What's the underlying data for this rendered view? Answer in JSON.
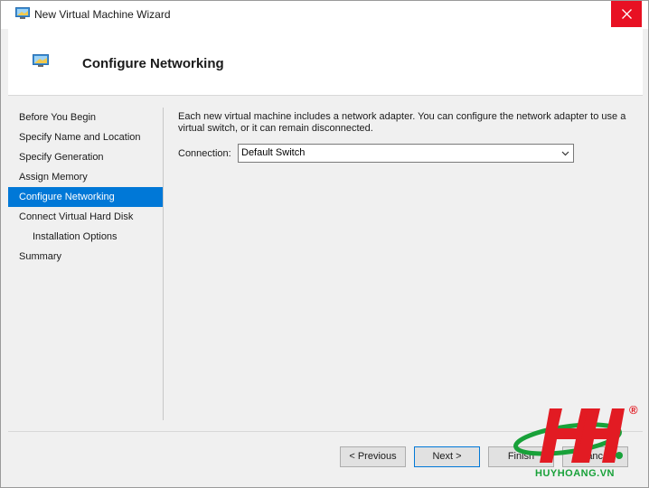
{
  "window": {
    "title": "New Virtual Machine Wizard",
    "close_icon": "close-icon"
  },
  "header": {
    "title": "Configure Networking",
    "icon": "network-monitor-icon"
  },
  "nav": {
    "items": [
      {
        "label": "Before You Begin"
      },
      {
        "label": "Specify Name and Location"
      },
      {
        "label": "Specify Generation"
      },
      {
        "label": "Assign Memory"
      },
      {
        "label": "Configure Networking"
      },
      {
        "label": "Connect Virtual Hard Disk"
      },
      {
        "label": "Installation Options"
      },
      {
        "label": "Summary"
      }
    ]
  },
  "content": {
    "description": "Each new virtual machine includes a network adapter. You can configure the network adapter to use a virtual switch, or it can remain disconnected.",
    "connection_label": "Connection:",
    "connection_value": "Default Switch"
  },
  "buttons": {
    "previous": "< Previous",
    "next": "Next >",
    "finish": "Finish",
    "cancel": "Cancel"
  },
  "watermark": {
    "text": "HUYHOANG.VN",
    "registered": "®"
  },
  "colors": {
    "accent": "#0078d7",
    "close": "#e81123",
    "watermark_red": "#e21b23",
    "watermark_green": "#18a139"
  }
}
